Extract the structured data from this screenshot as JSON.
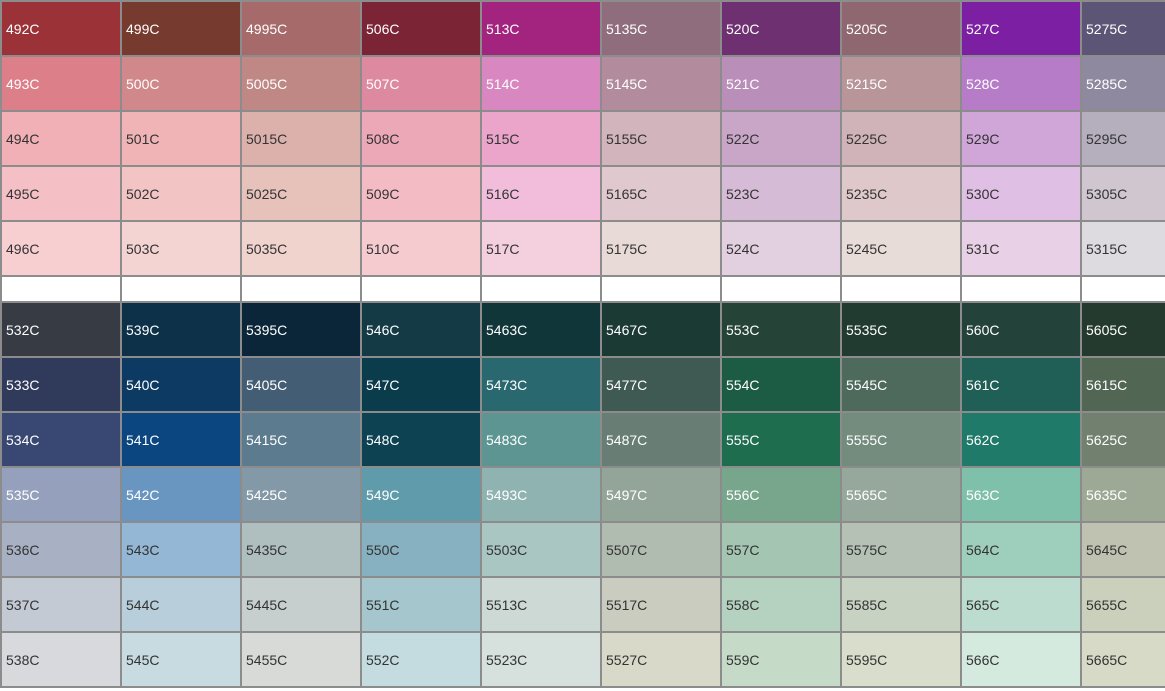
{
  "chart_data": {
    "type": "table",
    "sections": [
      {
        "rows": [
          [
            {
              "code": "492C",
              "color": "#9b3238",
              "text": "#ffffff"
            },
            {
              "code": "499C",
              "color": "#763a2e",
              "text": "#ffffff"
            },
            {
              "code": "4995C",
              "color": "#a66a6a",
              "text": "#ffffff"
            },
            {
              "code": "506C",
              "color": "#7a2436",
              "text": "#ffffff"
            },
            {
              "code": "513C",
              "color": "#a2247e",
              "text": "#ffffff"
            },
            {
              "code": "5135C",
              "color": "#906d7c",
              "text": "#ffffff"
            },
            {
              "code": "520C",
              "color": "#6e3070",
              "text": "#ffffff"
            },
            {
              "code": "5205C",
              "color": "#8e6770",
              "text": "#ffffff"
            },
            {
              "code": "527C",
              "color": "#7c1fa3",
              "text": "#ffffff"
            },
            {
              "code": "5275C",
              "color": "#5c5576",
              "text": "#ffffff"
            }
          ],
          [
            {
              "code": "493C",
              "color": "#dd7f88",
              "text": "#ffffff"
            },
            {
              "code": "500C",
              "color": "#d1888b",
              "text": "#ffffff"
            },
            {
              "code": "5005C",
              "color": "#c08885",
              "text": "#ffffff"
            },
            {
              "code": "507C",
              "color": "#dd8aa1",
              "text": "#ffffff"
            },
            {
              "code": "514C",
              "color": "#d887c0",
              "text": "#ffffff"
            },
            {
              "code": "5145C",
              "color": "#b28c9c",
              "text": "#ffffff"
            },
            {
              "code": "521C",
              "color": "#b98fba",
              "text": "#ffffff"
            },
            {
              "code": "5215C",
              "color": "#b79599",
              "text": "#ffffff"
            },
            {
              "code": "528C",
              "color": "#b67cc7",
              "text": "#ffffff"
            },
            {
              "code": "5285C",
              "color": "#8e899f",
              "text": "#ffffff"
            }
          ],
          [
            {
              "code": "494C",
              "color": "#f1b0b6",
              "text": "#333333"
            },
            {
              "code": "501C",
              "color": "#f0b3b6",
              "text": "#333333"
            },
            {
              "code": "5015C",
              "color": "#ddb1ab",
              "text": "#333333"
            },
            {
              "code": "508C",
              "color": "#eca8b6",
              "text": "#333333"
            },
            {
              "code": "515C",
              "color": "#eba5cb",
              "text": "#333333"
            },
            {
              "code": "5155C",
              "color": "#d1b4bc",
              "text": "#333333"
            },
            {
              "code": "522C",
              "color": "#c9a6c8",
              "text": "#333333"
            },
            {
              "code": "5225C",
              "color": "#d0b3b8",
              "text": "#333333"
            },
            {
              "code": "529C",
              "color": "#d0a5d8",
              "text": "#333333"
            },
            {
              "code": "5295C",
              "color": "#b4aebd",
              "text": "#333333"
            }
          ],
          [
            {
              "code": "495C",
              "color": "#f4c0c6",
              "text": "#333333"
            },
            {
              "code": "502C",
              "color": "#f3c4c4",
              "text": "#333333"
            },
            {
              "code": "5025C",
              "color": "#e6c2bb",
              "text": "#333333"
            },
            {
              "code": "509C",
              "color": "#f3bcc5",
              "text": "#333333"
            },
            {
              "code": "516C",
              "color": "#f1bddb",
              "text": "#333333"
            },
            {
              "code": "5165C",
              "color": "#dfc8ce",
              "text": "#333333"
            },
            {
              "code": "523C",
              "color": "#d6bbd6",
              "text": "#333333"
            },
            {
              "code": "5235C",
              "color": "#dfc8ca",
              "text": "#333333"
            },
            {
              "code": "530C",
              "color": "#dfbfe3",
              "text": "#333333"
            },
            {
              "code": "5305C",
              "color": "#cfc6d0",
              "text": "#333333"
            }
          ],
          [
            {
              "code": "496C",
              "color": "#f7cfd1",
              "text": "#333333"
            },
            {
              "code": "503C",
              "color": "#f4d4d2",
              "text": "#333333"
            },
            {
              "code": "5035C",
              "color": "#efd3cc",
              "text": "#333333"
            },
            {
              "code": "510C",
              "color": "#f6cbd0",
              "text": "#333333"
            },
            {
              "code": "517C",
              "color": "#f4d0de",
              "text": "#333333"
            },
            {
              "code": "5175C",
              "color": "#e8dad6",
              "text": "#333333"
            },
            {
              "code": "524C",
              "color": "#e2d0e0",
              "text": "#333333"
            },
            {
              "code": "5245C",
              "color": "#e8dcd8",
              "text": "#333333"
            },
            {
              "code": "531C",
              "color": "#e8d0e6",
              "text": "#333333"
            },
            {
              "code": "5315C",
              "color": "#dedbe0",
              "text": "#333333"
            }
          ]
        ]
      },
      {
        "rows": [
          [
            {
              "code": "532C",
              "color": "#363b44",
              "text": "#ffffff"
            },
            {
              "code": "539C",
              "color": "#0d3148",
              "text": "#ffffff"
            },
            {
              "code": "5395C",
              "color": "#0b2638",
              "text": "#ffffff"
            },
            {
              "code": "546C",
              "color": "#133a45",
              "text": "#ffffff"
            },
            {
              "code": "5463C",
              "color": "#11363a",
              "text": "#ffffff"
            },
            {
              "code": "5467C",
              "color": "#1b3a33",
              "text": "#ffffff"
            },
            {
              "code": "553C",
              "color": "#254337",
              "text": "#ffffff"
            },
            {
              "code": "5535C",
              "color": "#223b30",
              "text": "#ffffff"
            },
            {
              "code": "560C",
              "color": "#23433a",
              "text": "#ffffff"
            },
            {
              "code": "5605C",
              "color": "#243a2e",
              "text": "#ffffff"
            }
          ],
          [
            {
              "code": "533C",
              "color": "#303a5a",
              "text": "#ffffff"
            },
            {
              "code": "540C",
              "color": "#0d3a63",
              "text": "#ffffff"
            },
            {
              "code": "5405C",
              "color": "#435d74",
              "text": "#ffffff"
            },
            {
              "code": "547C",
              "color": "#0a3c4b",
              "text": "#ffffff"
            },
            {
              "code": "5473C",
              "color": "#2a6870",
              "text": "#ffffff"
            },
            {
              "code": "5477C",
              "color": "#3e5a52",
              "text": "#ffffff"
            },
            {
              "code": "554C",
              "color": "#1c5b44",
              "text": "#ffffff"
            },
            {
              "code": "5545C",
              "color": "#4d6a5d",
              "text": "#ffffff"
            },
            {
              "code": "561C",
              "color": "#1f5f55",
              "text": "#ffffff"
            },
            {
              "code": "5615C",
              "color": "#526654",
              "text": "#ffffff"
            }
          ],
          [
            {
              "code": "534C",
              "color": "#384873",
              "text": "#ffffff"
            },
            {
              "code": "541C",
              "color": "#0b4680",
              "text": "#ffffff"
            },
            {
              "code": "5415C",
              "color": "#5c7b8e",
              "text": "#ffffff"
            },
            {
              "code": "548C",
              "color": "#0c4252",
              "text": "#ffffff"
            },
            {
              "code": "5483C",
              "color": "#5d9592",
              "text": "#ffffff"
            },
            {
              "code": "5487C",
              "color": "#687e74",
              "text": "#ffffff"
            },
            {
              "code": "555C",
              "color": "#1e6d4f",
              "text": "#ffffff"
            },
            {
              "code": "5555C",
              "color": "#738c7e",
              "text": "#ffffff"
            },
            {
              "code": "562C",
              "color": "#1f7a69",
              "text": "#ffffff"
            },
            {
              "code": "5625C",
              "color": "#72806f",
              "text": "#ffffff"
            }
          ],
          [
            {
              "code": "535C",
              "color": "#95a1bc",
              "text": "#ffffff"
            },
            {
              "code": "542C",
              "color": "#6896c1",
              "text": "#ffffff"
            },
            {
              "code": "5425C",
              "color": "#8399a7",
              "text": "#ffffff"
            },
            {
              "code": "549C",
              "color": "#5f9bab",
              "text": "#ffffff"
            },
            {
              "code": "5493C",
              "color": "#8eb3b1",
              "text": "#ffffff"
            },
            {
              "code": "5497C",
              "color": "#93a499",
              "text": "#ffffff"
            },
            {
              "code": "556C",
              "color": "#78a68c",
              "text": "#ffffff"
            },
            {
              "code": "5565C",
              "color": "#95a89b",
              "text": "#ffffff"
            },
            {
              "code": "563C",
              "color": "#7fc0ab",
              "text": "#ffffff"
            },
            {
              "code": "5635C",
              "color": "#9ea995",
              "text": "#ffffff"
            }
          ],
          [
            {
              "code": "536C",
              "color": "#a8b1c3",
              "text": "#333333"
            },
            {
              "code": "543C",
              "color": "#93b7d4",
              "text": "#333333"
            },
            {
              "code": "5435C",
              "color": "#afbfbf",
              "text": "#333333"
            },
            {
              "code": "550C",
              "color": "#87b0c1",
              "text": "#333333"
            },
            {
              "code": "5503C",
              "color": "#a9c6c2",
              "text": "#333333"
            },
            {
              "code": "5507C",
              "color": "#b1bcb0",
              "text": "#333333"
            },
            {
              "code": "557C",
              "color": "#a3c5b2",
              "text": "#333333"
            },
            {
              "code": "5575C",
              "color": "#b4c1b4",
              "text": "#333333"
            },
            {
              "code": "564C",
              "color": "#9ecfbd",
              "text": "#333333"
            },
            {
              "code": "5645C",
              "color": "#bfc1b1",
              "text": "#333333"
            }
          ],
          [
            {
              "code": "537C",
              "color": "#c4cad3",
              "text": "#333333"
            },
            {
              "code": "544C",
              "color": "#b8ceda",
              "text": "#333333"
            },
            {
              "code": "5445C",
              "color": "#c7cece",
              "text": "#333333"
            },
            {
              "code": "551C",
              "color": "#a4c6cc",
              "text": "#333333"
            },
            {
              "code": "5513C",
              "color": "#ccd9d4",
              "text": "#333333"
            },
            {
              "code": "5517C",
              "color": "#c9ccbf",
              "text": "#333333"
            },
            {
              "code": "558C",
              "color": "#b5d1c0",
              "text": "#333333"
            },
            {
              "code": "5585C",
              "color": "#c8d2c3",
              "text": "#333333"
            },
            {
              "code": "565C",
              "color": "#bcdccf",
              "text": "#333333"
            },
            {
              "code": "5655C",
              "color": "#cbd0bd",
              "text": "#333333"
            }
          ],
          [
            {
              "code": "538C",
              "color": "#d8d9dd",
              "text": "#333333"
            },
            {
              "code": "545C",
              "color": "#c8dbe0",
              "text": "#333333"
            },
            {
              "code": "5455C",
              "color": "#d7dad6",
              "text": "#333333"
            },
            {
              "code": "552C",
              "color": "#c4dcdf",
              "text": "#333333"
            },
            {
              "code": "5523C",
              "color": "#d6e0dc",
              "text": "#333333"
            },
            {
              "code": "5527C",
              "color": "#d8d9c9",
              "text": "#333333"
            },
            {
              "code": "559C",
              "color": "#c6dbc7",
              "text": "#333333"
            },
            {
              "code": "5595C",
              "color": "#d9ddcb",
              "text": "#333333"
            },
            {
              "code": "566C",
              "color": "#d4eade",
              "text": "#333333"
            },
            {
              "code": "5665C",
              "color": "#d8dac8",
              "text": "#333333"
            }
          ]
        ]
      }
    ]
  }
}
